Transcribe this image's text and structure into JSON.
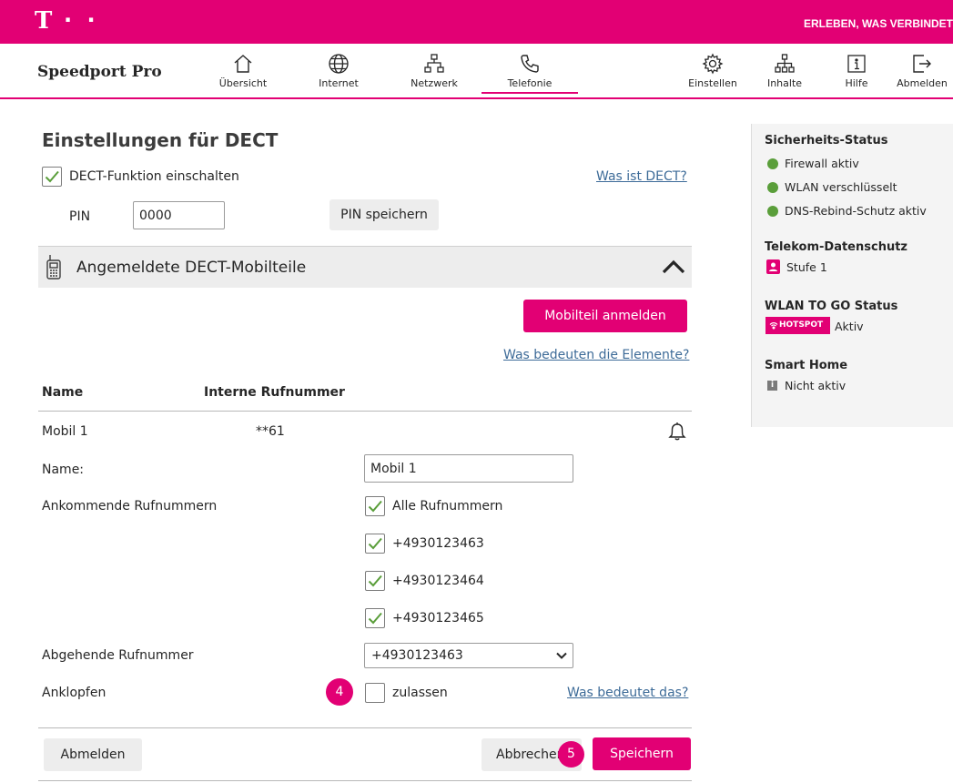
{
  "header": {
    "logo": "T",
    "logo_dots": "· ·",
    "claim": "ERLEBEN, WAS VERBINDET"
  },
  "nav": {
    "brand": "Speedport Pro",
    "left_items": [
      {
        "label": "Übersicht",
        "icon": "home-icon"
      },
      {
        "label": "Internet",
        "icon": "globe-icon"
      },
      {
        "label": "Netzwerk",
        "icon": "network-icon"
      },
      {
        "label": "Telefonie",
        "icon": "phone-icon",
        "active": true
      }
    ],
    "right_items": [
      {
        "label": "Einstellen",
        "icon": "gear-icon"
      },
      {
        "label": "Inhalte",
        "icon": "sitemap-icon"
      },
      {
        "label": "Hilfe",
        "icon": "info-icon"
      },
      {
        "label": "Abmelden",
        "icon": "logout-icon"
      }
    ]
  },
  "main": {
    "title": "Einstellungen für DECT",
    "dect_toggle": {
      "label": "DECT-Funktion einschalten",
      "checked": true
    },
    "dect_help_link": "Was ist DECT?",
    "pin": {
      "label": "PIN",
      "value": "0000",
      "save_button": "PIN speichern"
    },
    "accordion": {
      "title": "Angemeldete DECT-Mobilteile",
      "icon": "handset-icon",
      "expanded": true
    },
    "register_button": "Mobilteil anmelden",
    "elements_help_link": "Was bedeuten die Elemente?",
    "table": {
      "columns": [
        "Name",
        "Interne Rufnummer"
      ],
      "rows": [
        {
          "name": "Mobil 1",
          "internal_number": "**61",
          "icon": "bell-icon"
        }
      ]
    },
    "detail": {
      "name_label": "Name:",
      "name_value": "Mobil 1",
      "incoming_label": "Ankommende Rufnummern",
      "incoming_options": [
        {
          "label": "Alle Rufnummern",
          "checked": true
        },
        {
          "label": "+4930123463",
          "checked": true
        },
        {
          "label": "+4930123464",
          "checked": true
        },
        {
          "label": "+4930123465",
          "checked": true
        }
      ],
      "outgoing_label": "Abgehende Rufnummer",
      "outgoing_selected": "+4930123463",
      "knock_label": "Anklopfen",
      "knock_option": {
        "label": "zulassen",
        "checked": false
      },
      "knock_help_link": "Was bedeutet das?",
      "badge_4": "4",
      "badge_5": "5"
    },
    "footer": {
      "unregister_button": "Abmelden",
      "cancel_button": "Abbrechen",
      "save_button": "Speichern"
    }
  },
  "sidebar": {
    "security": {
      "title": "Sicherheits-Status",
      "items": [
        "Firewall aktiv",
        "WLAN verschlüsselt",
        "DNS-Rebind-Schutz aktiv"
      ]
    },
    "privacy": {
      "title": "Telekom-Datenschutz",
      "value": "Stufe 1"
    },
    "wlan_to_go": {
      "title": "WLAN TO GO Status",
      "badge": "HOTSPOT",
      "value": "Aktiv"
    },
    "smart_home": {
      "title": "Smart Home",
      "value": "Nicht aktiv"
    }
  },
  "colors": {
    "brand": "#e20074",
    "check": "#5a9e3a",
    "link": "#3d6b98",
    "panel": "#ededed"
  }
}
